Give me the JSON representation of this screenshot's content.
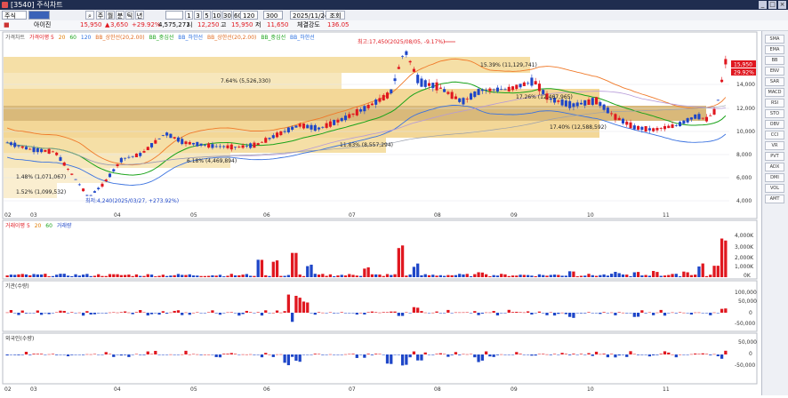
{
  "window": {
    "title": "[3540] 주식차트"
  },
  "toolbar": {
    "market": "주식",
    "code_placeholder": "",
    "periods": [
      "주",
      "월",
      "분",
      "틱",
      "년"
    ],
    "minutes": [
      "1",
      "3",
      "5",
      "10",
      "30",
      "60"
    ],
    "count": "120",
    "view": "300",
    "date": "2025/11/24",
    "search_label": "조회"
  },
  "info": {
    "stock_name": "아이진",
    "price": "15,950",
    "change": "3,650",
    "change_pct": "+29.92%",
    "volume": "4,575,271",
    "open_label": "시",
    "open": "12,250",
    "high_label": "고",
    "high": "15,950",
    "low_label": "저",
    "low": "11,650",
    "extra_label": "체결강도",
    "extra": "136.05"
  },
  "colors": {
    "up": "#e0171f",
    "down": "#1e46c8",
    "band": "#f5dfa6",
    "band_dark": "#d9b97a"
  },
  "chart": {
    "legend_price": [
      "가격차트",
      "가격이평 5",
      "20",
      "60",
      "120",
      "BB_상한선(20,2.00)",
      "BB_중심선",
      "BB_하한선",
      "BB_상한선(20,2.00)",
      "BB_중심선",
      "BB_하한선"
    ],
    "price_axis": [
      "14,000",
      "12,000",
      "10,000",
      "8,000",
      "6,000",
      "4,000"
    ],
    "last_price_tag": "15,950",
    "last_pct_tag": "29.92%",
    "annotations": [
      "최고:17,450(2025/08/05, -9.17%)",
      "15.39% (11,129,741)",
      "7.64% (5,526,330)",
      "17.26% (12,467,965)",
      "17.40% (12,588,592)",
      "11.83% (8,557,294)",
      "6.18% (4,469,894)",
      "1.48% (1,071,067)",
      "1.52% (1,099,532)",
      "최저:4,240(2025/03/27, +273.92%)"
    ],
    "months": [
      "02",
      "03",
      "04",
      "05",
      "06",
      "07",
      "08",
      "09",
      "10",
      "11"
    ],
    "volume_legend": [
      "거래이평 5",
      "20",
      "60",
      "거래량"
    ],
    "volume_axis": [
      "4,000K",
      "3,000K",
      "2,000K",
      "1,000K",
      "0K"
    ],
    "inst_legend": "기관(수량)",
    "inst_axis": [
      "100,000",
      "50,000",
      "0",
      "-50,000"
    ],
    "foreign_legend": "외국인(수량)",
    "foreign_axis": [
      "50,000",
      "0",
      "-50,000"
    ]
  },
  "sidebar": [
    "SMA",
    "EMA",
    "BB",
    "ENV",
    "SAR",
    "MACD",
    "RSI",
    "STO",
    "OBV",
    "CCI",
    "VR",
    "PVT",
    "ADX",
    "DMI",
    "VOL",
    "AMT"
  ]
}
